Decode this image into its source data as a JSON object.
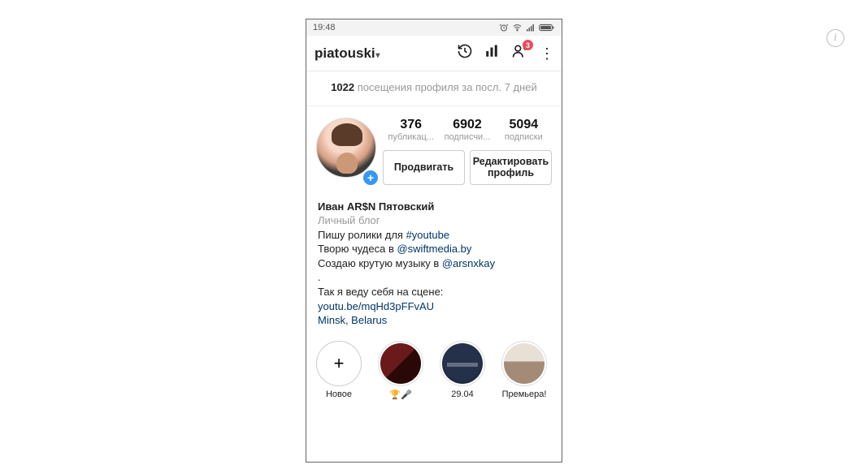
{
  "corner_info": "i",
  "statusbar": {
    "time": "19:48"
  },
  "header": {
    "username": "piatouski",
    "badge_count": "3"
  },
  "visits": {
    "count": "1022",
    "label_1": " посещения профиля за посл. ",
    "label_2": "7 дней"
  },
  "stats": {
    "posts": {
      "num": "376",
      "label": "публикац..."
    },
    "followers": {
      "num": "6902",
      "label": "подписчи..."
    },
    "following": {
      "num": "5094",
      "label": "подписки"
    }
  },
  "actions": {
    "promote": "Продвигать",
    "edit": "Редактировать профиль"
  },
  "bio": {
    "name": "Иван AR$N Пятовский",
    "category": "Личный блог",
    "line1_a": "Пишу ролики для ",
    "line1_b": "#youtube",
    "line2_a": "Творю чудеса в ",
    "line2_b": "@swiftmedia.by",
    "line3_a": "Создаю крутую музыку в ",
    "line3_b": "@arsnxkay",
    "dot": ".",
    "line4": "Так я веду себя на сцене:",
    "url": "youtu.be/mqHd3pFFvAU",
    "location": "Minsk, Belarus"
  },
  "highlights": {
    "new": {
      "label": "Новое"
    },
    "h1": {
      "label": "🏆🎤"
    },
    "h2": {
      "label": "29.04"
    },
    "h3": {
      "label": "Премьера!"
    }
  }
}
